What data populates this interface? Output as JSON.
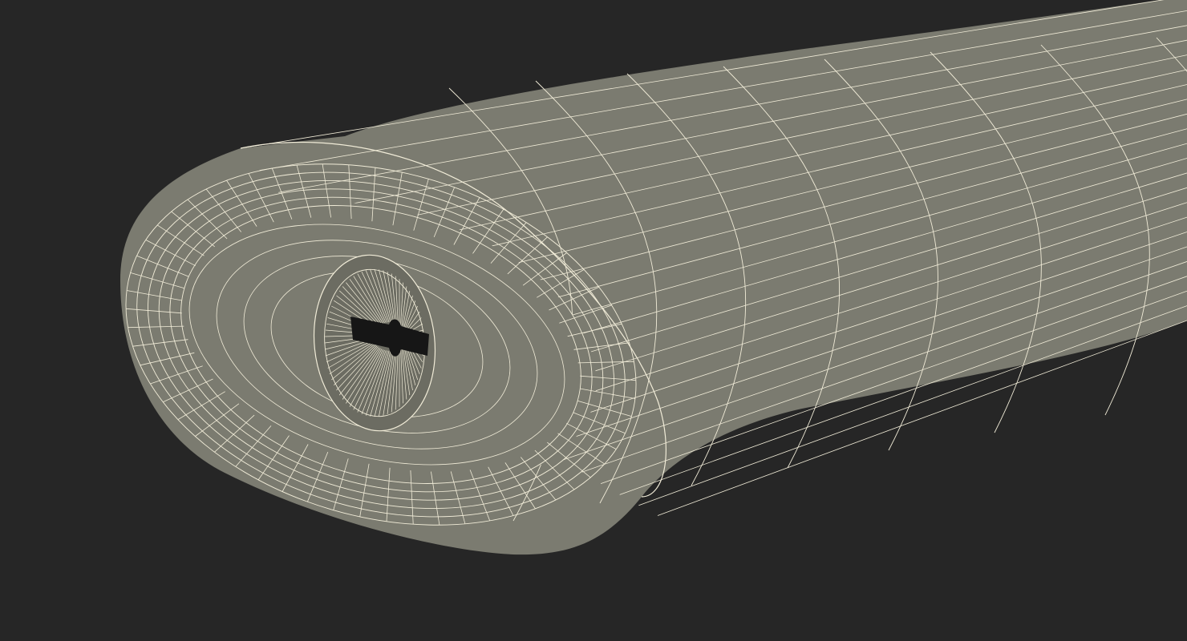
{
  "scene": {
    "background_color": "#262626",
    "surface_color": "#7b7b70",
    "surface_dark_color": "#6c6c62",
    "wire_color": "#f1ecd8",
    "slot_color": "#161616"
  },
  "render": {
    "mode": "wireframe-on-shaded",
    "object": "capsule-handle-end-with-keyhole"
  }
}
